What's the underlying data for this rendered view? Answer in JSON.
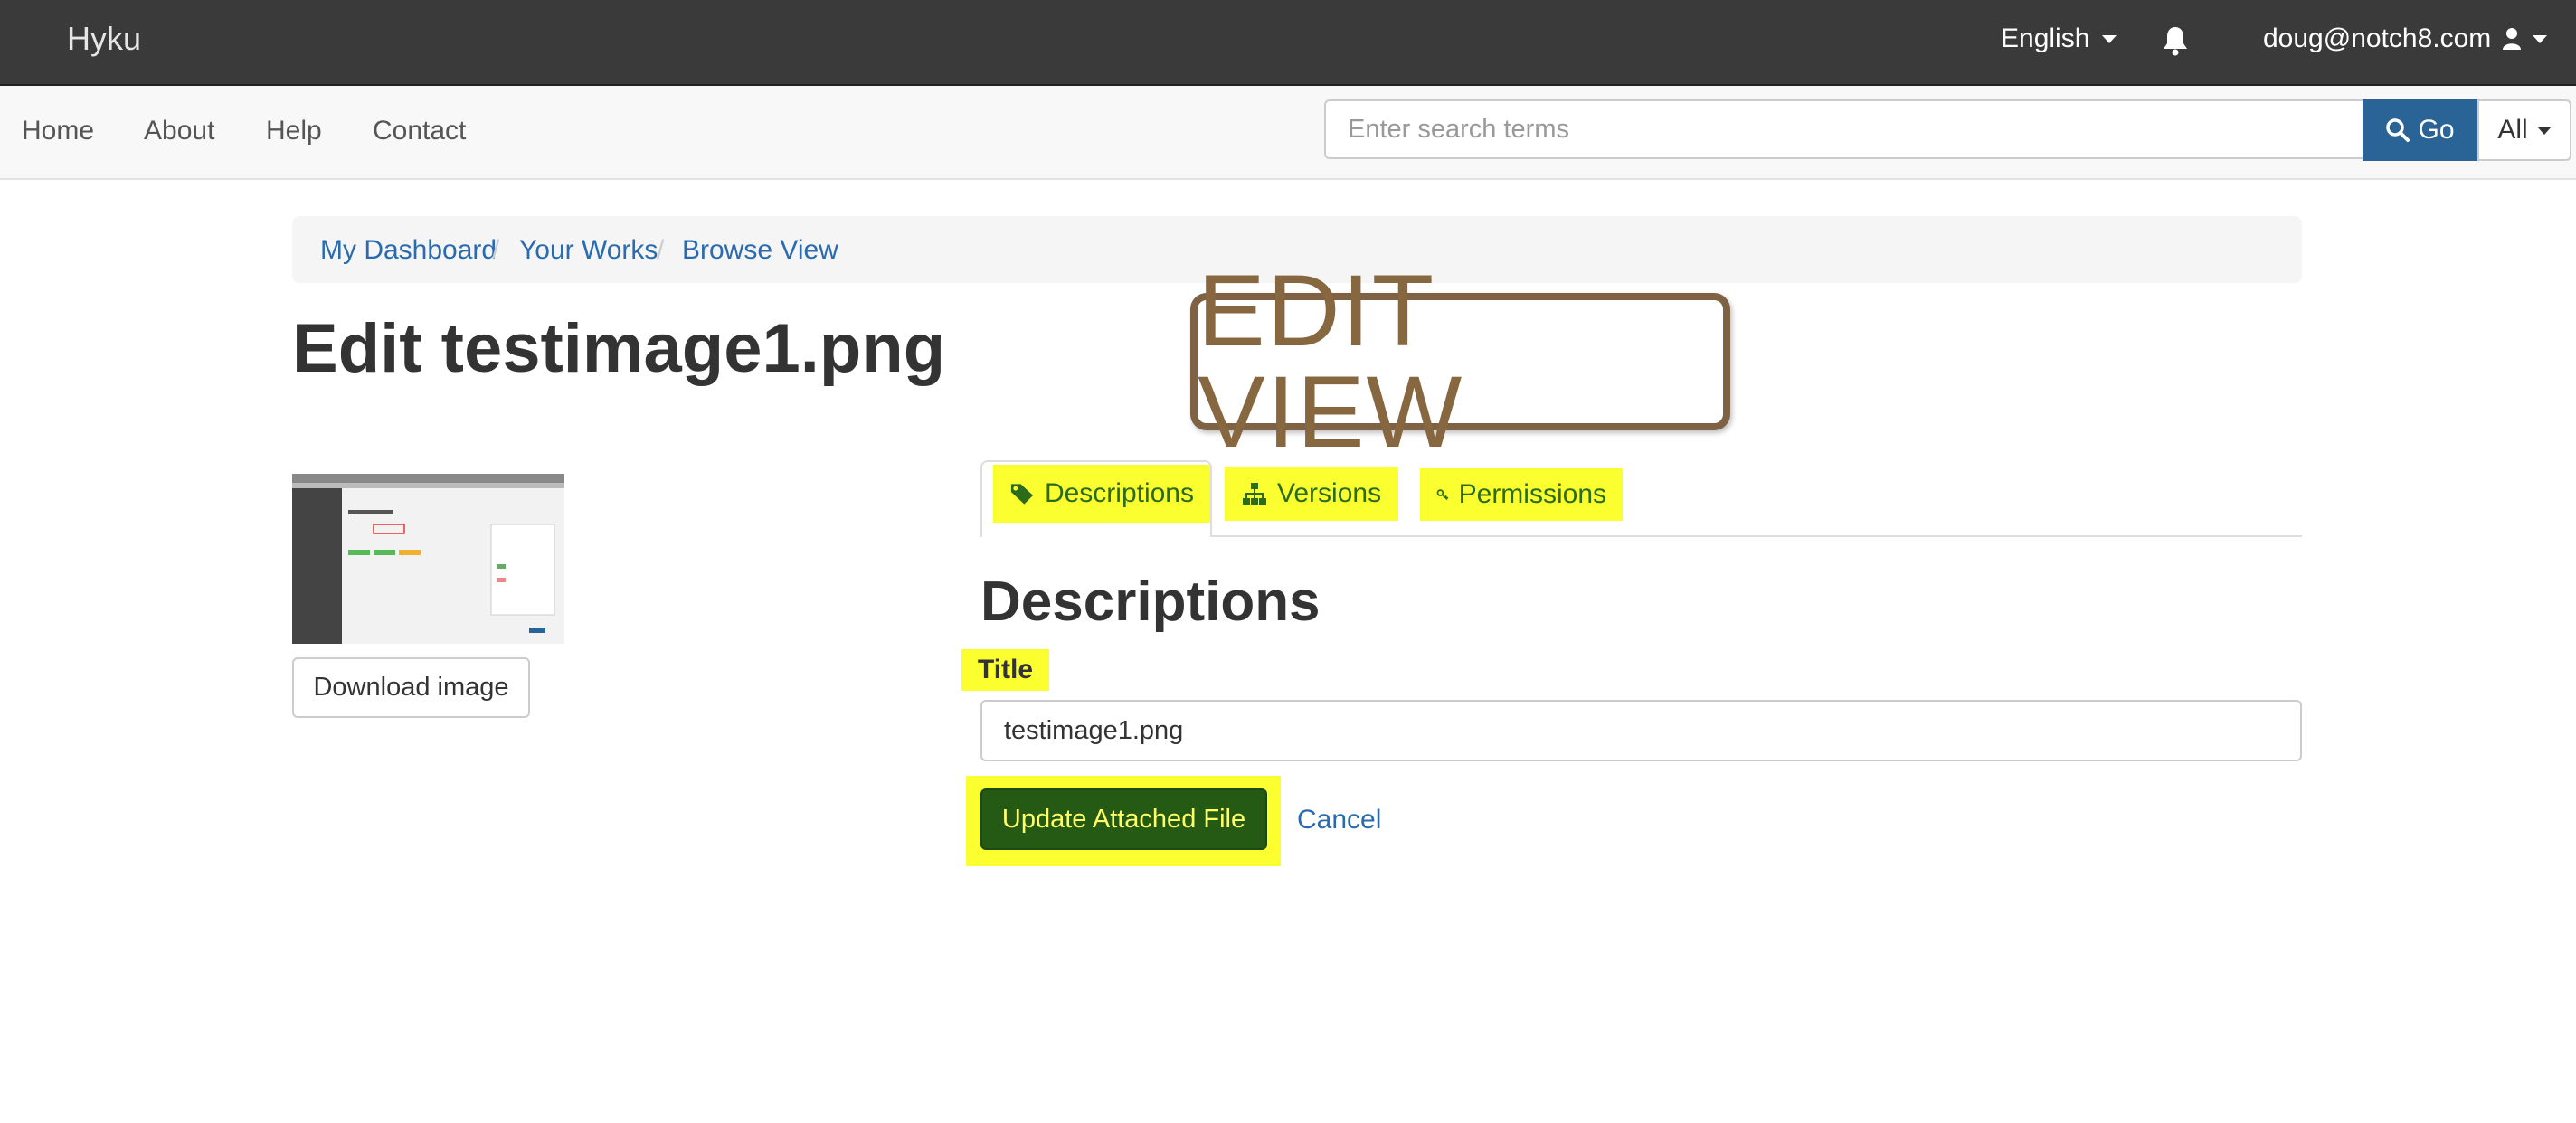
{
  "navbar": {
    "brand": "Hyku",
    "language": "English",
    "user_email": "doug@notch8.com"
  },
  "subnav": {
    "links": [
      "Home",
      "About",
      "Help",
      "Contact"
    ],
    "search_placeholder": "Enter search terms",
    "search_button": "Go",
    "scope": "All"
  },
  "breadcrumb": [
    "My Dashboard",
    "Your Works",
    "Browse View"
  ],
  "page": {
    "title": "Edit testimage1.png",
    "annotation": "EDIT VIEW",
    "download_button": "Download image"
  },
  "tabs": [
    "Descriptions",
    "Versions",
    "Permissions"
  ],
  "form": {
    "section_title": "Descriptions",
    "title_label": "Title",
    "title_value": "testimage1.png",
    "submit_label": "Update Attached File",
    "cancel_label": "Cancel"
  },
  "colors": {
    "navbar_bg": "#3a3a3a",
    "link": "#2a6bb0",
    "search_button_bg": "#2a6496",
    "highlight": "#fbff30",
    "submit_bg": "#245a14",
    "annotation_border": "#7e6243"
  },
  "icons": {
    "notifications": "bell-icon",
    "user": "user-icon",
    "search": "search-icon",
    "tab_descriptions": "tags-icon",
    "tab_versions": "sitemap-icon",
    "tab_permissions": "key-icon"
  }
}
